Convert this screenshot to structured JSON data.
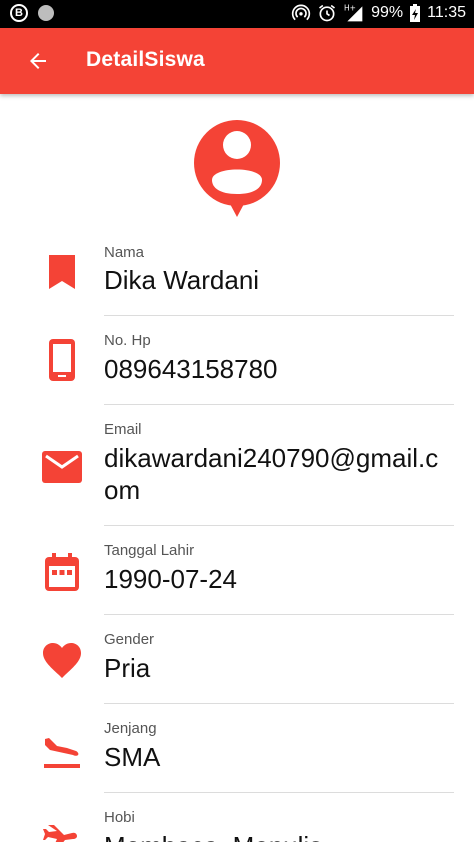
{
  "status_bar": {
    "left_badge": "B",
    "battery": "99%",
    "time": "11:35"
  },
  "app_bar": {
    "title": "DetailSiswa"
  },
  "colors": {
    "primary": "#f44336",
    "icon": "#f44336"
  },
  "fields": [
    {
      "label": "Nama",
      "value": "Dika Wardani",
      "icon": "bookmark-icon"
    },
    {
      "label": "No. Hp",
      "value": "089643158780",
      "icon": "phone-icon"
    },
    {
      "label": "Email",
      "value": "dikawardani240790@gmail.com",
      "icon": "email-icon"
    },
    {
      "label": "Tanggal Lahir",
      "value": "1990-07-24",
      "icon": "calendar-icon"
    },
    {
      "label": "Gender",
      "value": "Pria",
      "icon": "heart-icon"
    },
    {
      "label": "Jenjang",
      "value": "SMA",
      "icon": "airplane-landing-icon"
    },
    {
      "label": "Hobi",
      "value": "Membaca, Menulis",
      "icon": "airplane-icon"
    }
  ]
}
